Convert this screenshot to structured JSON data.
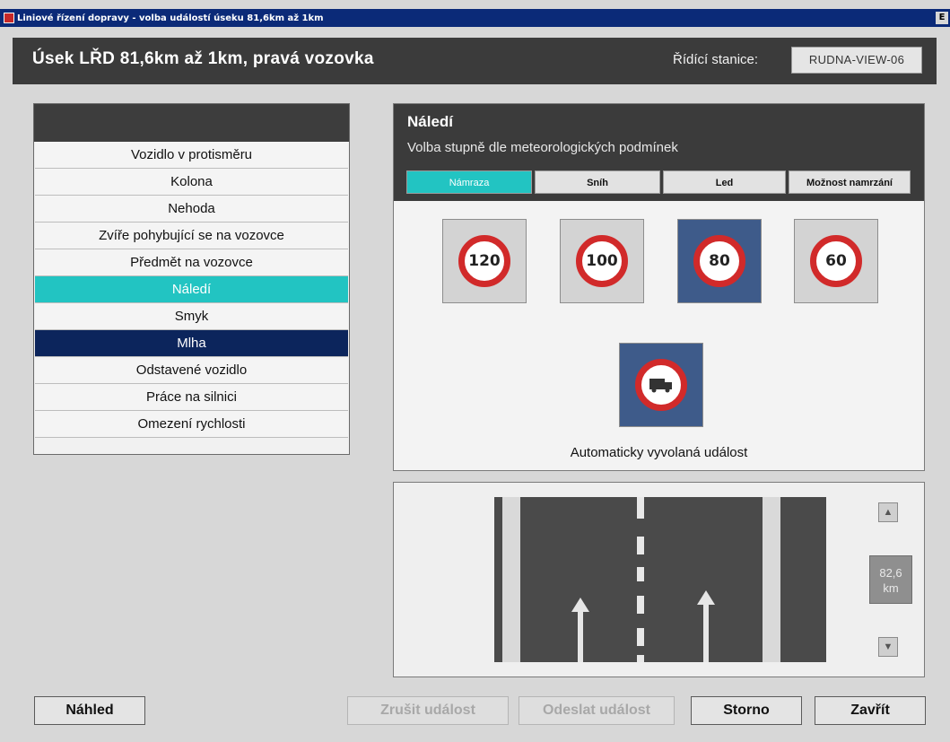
{
  "window": {
    "title": "Liniové řízení dopravy - volba událostí úseku 81,6km až 1km",
    "close_glyph": "E"
  },
  "header": {
    "title": "Úsek LŘD 81,6km až 1km, pravá vozovka",
    "station_label": "Řídící stanice:",
    "station_value": "RUDNA-VIEW-06"
  },
  "events": {
    "items": [
      {
        "label": "Vozidlo v protisměru",
        "state": "normal"
      },
      {
        "label": "Kolona",
        "state": "normal"
      },
      {
        "label": "Nehoda",
        "state": "normal"
      },
      {
        "label": "Zvíře pohybující se na vozovce",
        "state": "normal"
      },
      {
        "label": "Předmět na vozovce",
        "state": "normal"
      },
      {
        "label": "Náledí",
        "state": "selected"
      },
      {
        "label": "Smyk",
        "state": "normal"
      },
      {
        "label": "Mlha",
        "state": "active"
      },
      {
        "label": "Odstavené vozidlo",
        "state": "normal"
      },
      {
        "label": "Práce na silnici",
        "state": "normal"
      },
      {
        "label": "Omezení rychlosti",
        "state": "normal"
      }
    ]
  },
  "ice": {
    "title": "Náledí",
    "subtitle": "Volba stupně dle meteorologických podmínek",
    "tabs": [
      "Námraza",
      "Sníh",
      "Led",
      "Možnost namrzání"
    ],
    "selected_tab": "Námraza",
    "signs": [
      "120",
      "100",
      "80",
      "60"
    ],
    "active_sign": "80",
    "truck_sign": "no-trucks-icon",
    "auto_label": "Automaticky vyvolaná událost"
  },
  "road": {
    "km_value": "82,6",
    "km_unit": "km",
    "up_icon": "▲",
    "down_icon": "▼"
  },
  "buttons": {
    "preview": "Náhled",
    "cancel_event": "Zrušit událost",
    "send_event": "Odeslat událost",
    "storno": "Storno",
    "close": "Zavřít"
  },
  "colors": {
    "accent_cyan": "#22c4c2",
    "active_navy": "#0c255c",
    "header_dark": "#3b3b3b",
    "sign_red": "#d12a2a"
  }
}
